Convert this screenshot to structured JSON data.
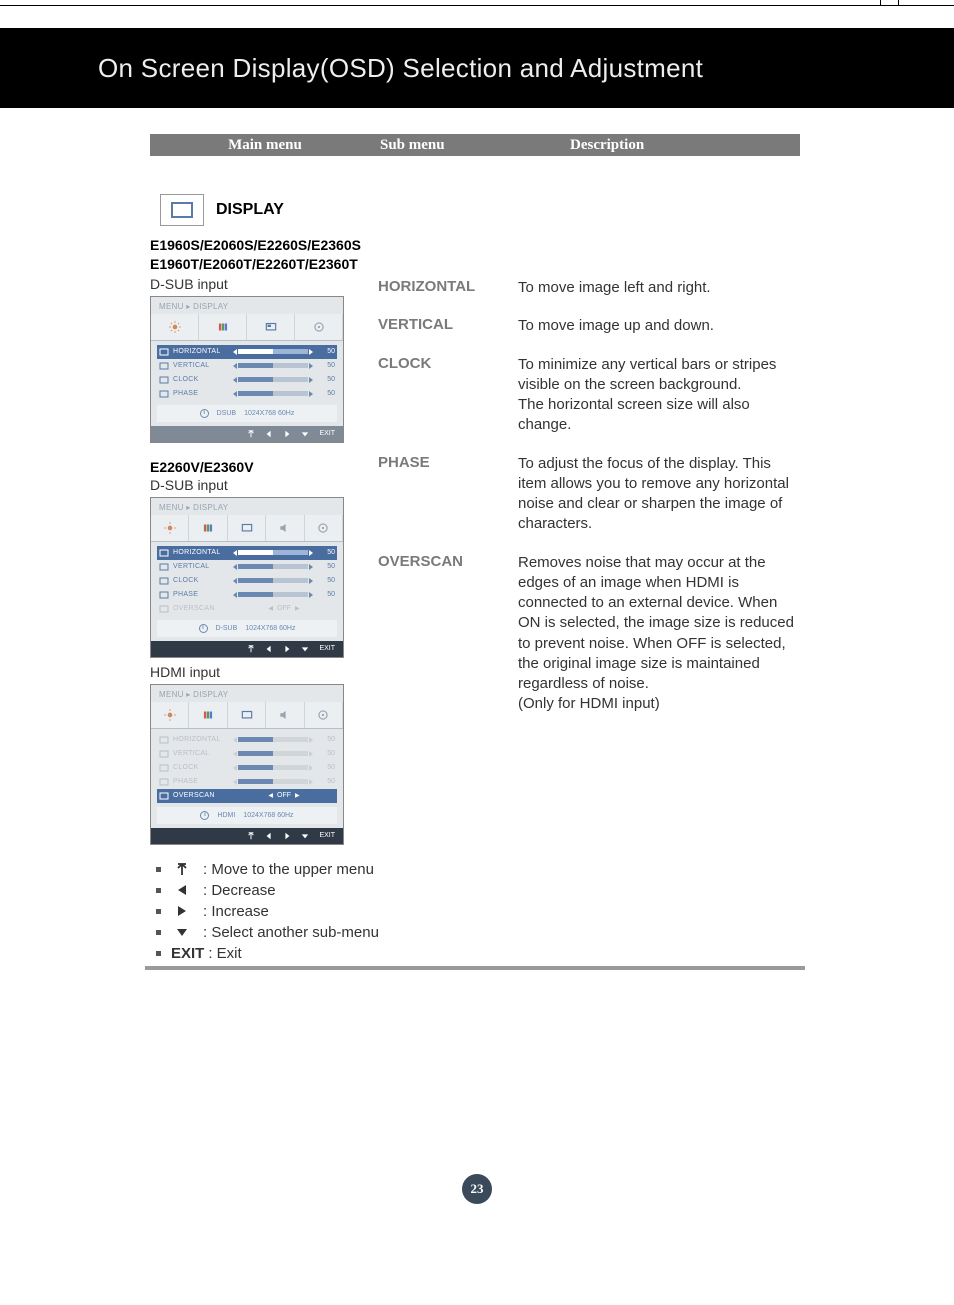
{
  "page_title": "On Screen Display(OSD) Selection and Adjustment",
  "columns": {
    "c1": "Main menu",
    "c2": "Sub menu",
    "c3": "Description"
  },
  "display": {
    "label": "DISPLAY",
    "model_line_1": "E1960S/E2060S/E2260S/E2360S",
    "model_line_2": "E1960T/E2060T/E2260T/E2360T",
    "dsub_label": "D-SUB input",
    "section2_models": "E2260V/E2360V",
    "hdmi_label": "HDMI input"
  },
  "osd_common": {
    "breadcrumb": "MENU ▸ DISPLAY",
    "exit": "EXIT"
  },
  "osd1": {
    "rows": [
      {
        "label": "HORIZONTAL",
        "val": "50",
        "sel": true
      },
      {
        "label": "VERTICAL",
        "val": "50"
      },
      {
        "label": "CLOCK",
        "val": "50"
      },
      {
        "label": "PHASE",
        "val": "50"
      }
    ],
    "info_source": "DSUB",
    "info_res": "1024X768   60Hz"
  },
  "osd2": {
    "rows": [
      {
        "label": "HORIZONTAL",
        "val": "50",
        "sel": true
      },
      {
        "label": "VERTICAL",
        "val": "50"
      },
      {
        "label": "CLOCK",
        "val": "50"
      },
      {
        "label": "PHASE",
        "val": "50"
      },
      {
        "label": "OVERSCAN",
        "val": "OFF",
        "dim": true,
        "toggle": true
      }
    ],
    "info_source": "D-SUB",
    "info_res": "1024X768  60Hz"
  },
  "osd3": {
    "rows": [
      {
        "label": "HORIZONTAL",
        "val": "50",
        "dim": true
      },
      {
        "label": "VERTICAL",
        "val": "50",
        "dim": true
      },
      {
        "label": "CLOCK",
        "val": "50",
        "dim": true
      },
      {
        "label": "PHASE",
        "val": "50",
        "dim": true
      },
      {
        "label": "OVERSCAN",
        "val": "OFF",
        "sel": true,
        "toggle": true
      }
    ],
    "info_source": "HDMI",
    "info_res": "1024X768  60Hz"
  },
  "submenu": {
    "horizontal": {
      "title": "HORIZONTAL",
      "desc": "To move image left and right."
    },
    "vertical": {
      "title": "VERTICAL",
      "desc": "To move image up and down."
    },
    "clock": {
      "title": "CLOCK",
      "desc": "To minimize any vertical bars or stripes visible on the screen background.\nThe horizontal screen size will also change."
    },
    "phase": {
      "title": "PHASE",
      "desc": "To adjust the focus of the display. This item allows you to remove any horizontal noise and clear or sharpen the image of characters."
    },
    "overscan": {
      "title": "OVERSCAN",
      "desc": "Removes noise that may occur at the edges of an image when HDMI is connected to an external device.  When ON is selected, the image size is reduced to prevent noise. When OFF is selected, the original image size is maintained regardless of noise.\n(Only for HDMI input)"
    }
  },
  "legend": {
    "up": ": Move to the upper menu",
    "left": ": Decrease",
    "right": ": Increase",
    "down": ": Select another sub-menu",
    "exit_label": "EXIT",
    "exit_text": ": Exit"
  },
  "page_number": "23"
}
